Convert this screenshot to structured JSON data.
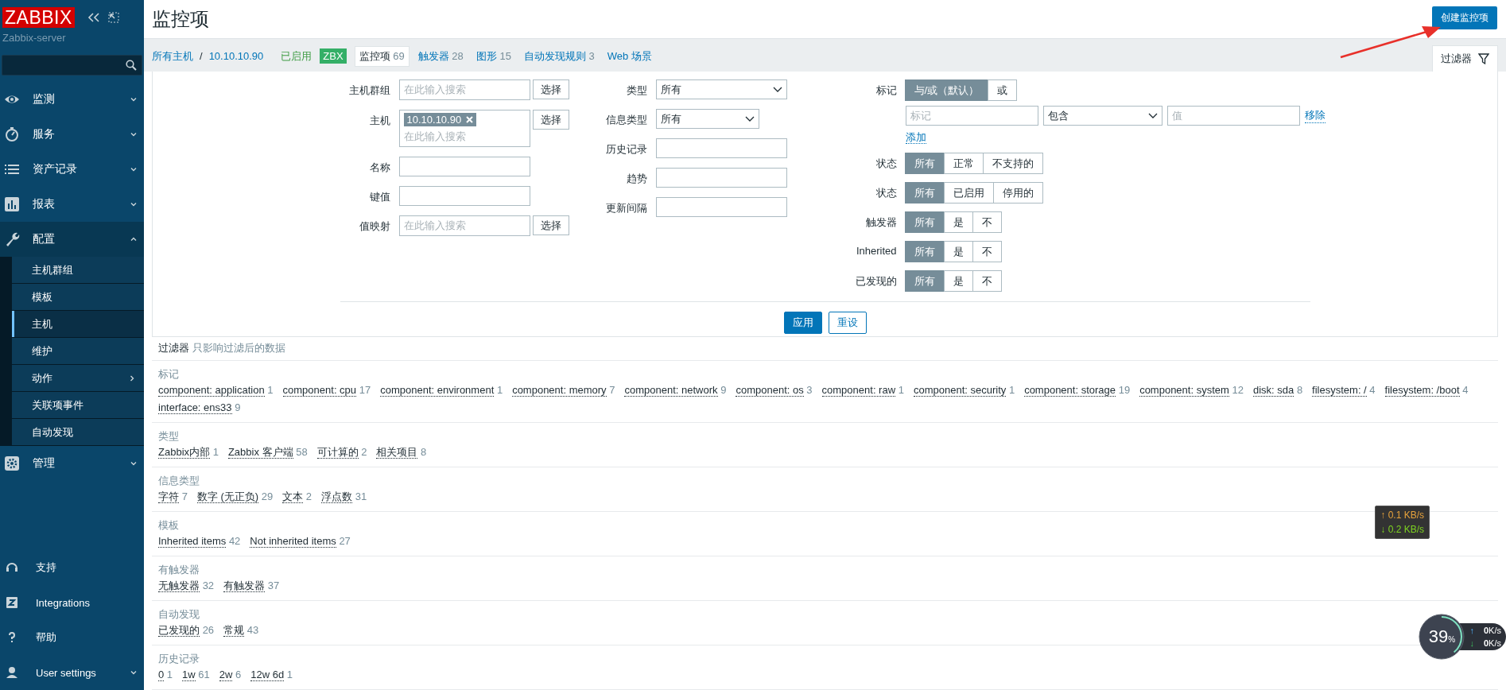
{
  "sidebar": {
    "logo": "ZABBIX",
    "server": "Zabbix-server",
    "menu": [
      {
        "label": "监测",
        "expanded": false,
        "selected": false
      },
      {
        "label": "服务",
        "expanded": false,
        "selected": false
      },
      {
        "label": "资产记录",
        "expanded": false,
        "selected": false
      },
      {
        "label": "报表",
        "expanded": false,
        "selected": false
      },
      {
        "label": "配置",
        "expanded": true,
        "selected": true,
        "children": [
          {
            "label": "主机群组",
            "selected": false,
            "submenu": false
          },
          {
            "label": "模板",
            "selected": false,
            "submenu": false
          },
          {
            "label": "主机",
            "selected": true,
            "submenu": false
          },
          {
            "label": "维护",
            "selected": false,
            "submenu": false
          },
          {
            "label": "动作",
            "selected": false,
            "submenu": true
          },
          {
            "label": "关联项事件",
            "selected": false,
            "submenu": false
          },
          {
            "label": "自动发现",
            "selected": false,
            "submenu": false
          }
        ]
      },
      {
        "label": "管理",
        "expanded": false,
        "selected": false
      }
    ],
    "bottom": [
      {
        "label": "支持"
      },
      {
        "label": "Integrations"
      },
      {
        "label": "帮助"
      },
      {
        "label": "User settings",
        "expanded": false
      }
    ]
  },
  "header": {
    "title": "监控项",
    "create_button": "创建监控项"
  },
  "nav": {
    "breadcrumbs": [
      "所有主机",
      "10.10.10.90"
    ],
    "separator": "/",
    "status": "已启用",
    "badge": "ZBX",
    "tabs": [
      {
        "label": "监控项",
        "count": "69",
        "selected": true
      },
      {
        "label": "触发器",
        "count": "28",
        "selected": false
      },
      {
        "label": "图形",
        "count": "15",
        "selected": false
      },
      {
        "label": "自动发现规则",
        "count": "3",
        "selected": false
      },
      {
        "label": "Web 场景",
        "selected": false
      }
    ],
    "filter_tab": "过滤器"
  },
  "filter": {
    "column_1": [
      {
        "label": "主机群组",
        "kind": "multiselect",
        "placeholder": "在此输入搜索",
        "button": "选择"
      },
      {
        "label": "主机",
        "kind": "multiselect",
        "tags": [
          "10.10.10.90"
        ],
        "placeholder": "在此输入搜索",
        "button": "选择"
      },
      {
        "label": "名称",
        "kind": "text"
      },
      {
        "label": "键值",
        "kind": "text"
      },
      {
        "label": "值映射",
        "kind": "multiselect",
        "placeholder": "在此输入搜索",
        "button": "选择"
      }
    ],
    "column_2": [
      {
        "label": "类型",
        "kind": "select",
        "value": "所有"
      },
      {
        "label": "信息类型",
        "kind": "select_narrow",
        "value": "所有"
      },
      {
        "label": "历史记录",
        "kind": "text"
      },
      {
        "label": "趋势",
        "kind": "text"
      },
      {
        "label": "更新间隔",
        "kind": "text"
      }
    ],
    "tags": {
      "label": "标记",
      "options": [
        {
          "label": "与/或（默认）",
          "selected": true
        },
        {
          "label": "或",
          "selected": false
        }
      ],
      "tag_placeholder": "标记",
      "operator": "包含",
      "value_placeholder": "值",
      "remove": "移除",
      "add": "添加"
    },
    "column_3": [
      {
        "label": "状态",
        "options": [
          {
            "label": "所有",
            "selected": true
          },
          {
            "label": "正常",
            "selected": false
          },
          {
            "label": "不支持的",
            "selected": false
          }
        ]
      },
      {
        "label": "状态",
        "options": [
          {
            "label": "所有",
            "selected": true
          },
          {
            "label": "已启用",
            "selected": false
          },
          {
            "label": "停用的",
            "selected": false
          }
        ]
      },
      {
        "label": "触发器",
        "options": [
          {
            "label": "所有",
            "selected": true
          },
          {
            "label": "是",
            "selected": false
          },
          {
            "label": "不",
            "selected": false
          }
        ]
      },
      {
        "label": "Inherited",
        "options": [
          {
            "label": "所有",
            "selected": true
          },
          {
            "label": "是",
            "selected": false
          },
          {
            "label": "不",
            "selected": false
          }
        ]
      },
      {
        "label": "已发现的",
        "options": [
          {
            "label": "所有",
            "selected": true
          },
          {
            "label": "是",
            "selected": false
          },
          {
            "label": "不",
            "selected": false
          }
        ]
      }
    ],
    "apply": "应用",
    "reset": "重设"
  },
  "subfilter": {
    "title": "过滤器",
    "note": "只影响过滤后的数据",
    "sections": [
      {
        "title": "标记",
        "items": [
          {
            "label": "component: application",
            "count": "1"
          },
          {
            "label": "component: cpu",
            "count": "17"
          },
          {
            "label": "component: environment",
            "count": "1"
          },
          {
            "label": "component: memory",
            "count": "7"
          },
          {
            "label": "component: network",
            "count": "9"
          },
          {
            "label": "component: os",
            "count": "3"
          },
          {
            "label": "component: raw",
            "count": "1"
          },
          {
            "label": "component: security",
            "count": "1"
          },
          {
            "label": "component: storage",
            "count": "19"
          },
          {
            "label": "component: system",
            "count": "12"
          },
          {
            "label": "disk: sda",
            "count": "8"
          },
          {
            "label": "filesystem: /",
            "count": "4"
          },
          {
            "label": "filesystem: /boot",
            "count": "4"
          },
          {
            "label": "interface: ens33",
            "count": "9"
          }
        ]
      },
      {
        "title": "类型",
        "items": [
          {
            "label": "Zabbix内部",
            "count": "1"
          },
          {
            "label": "Zabbix 客户端",
            "count": "58"
          },
          {
            "label": "可计算的",
            "count": "2"
          },
          {
            "label": "相关项目",
            "count": "8"
          }
        ]
      },
      {
        "title": "信息类型",
        "items": [
          {
            "label": "字符",
            "count": "7"
          },
          {
            "label": "数字 (无正负)",
            "count": "29"
          },
          {
            "label": "文本",
            "count": "2"
          },
          {
            "label": "浮点数",
            "count": "31"
          }
        ]
      },
      {
        "title": "模板",
        "items": [
          {
            "label": "Inherited items",
            "count": "42"
          },
          {
            "label": "Not inherited items",
            "count": "27"
          }
        ]
      },
      {
        "title": "有触发器",
        "items": [
          {
            "label": "无触发器",
            "count": "32"
          },
          {
            "label": "有触发器",
            "count": "37"
          }
        ]
      },
      {
        "title": "自动发现",
        "items": [
          {
            "label": "已发现的",
            "count": "26"
          },
          {
            "label": "常规",
            "count": "43"
          }
        ]
      },
      {
        "title": "历史记录",
        "items": [
          {
            "label": "0",
            "count": "1"
          },
          {
            "label": "1w",
            "count": "61"
          },
          {
            "label": "2w",
            "count": "6"
          },
          {
            "label": "12w 6d",
            "count": "1"
          }
        ]
      }
    ]
  },
  "net_speed": {
    "up_arrow": "↑",
    "up": "0.1 KB/s",
    "down_arrow": "↓",
    "down": "0.2 KB/s"
  },
  "speed_widget": {
    "percent": "39",
    "unit": "%",
    "level": 0.39,
    "up_arrow": "↑",
    "up": "0",
    "up_unit": "K/s",
    "down_arrow": "↓",
    "down": "0",
    "down_unit": "K/s"
  }
}
